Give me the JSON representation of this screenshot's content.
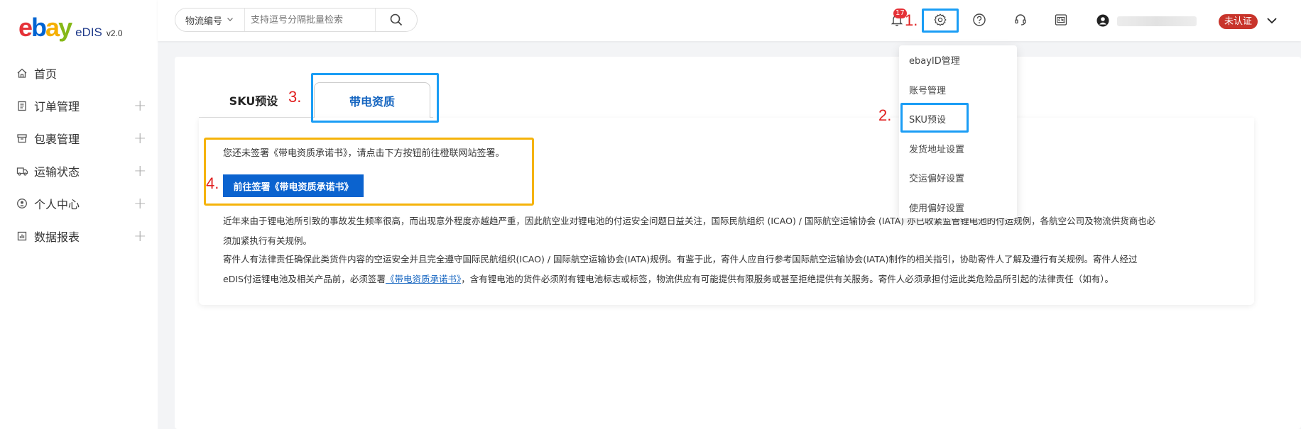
{
  "app": {
    "logo_letters": [
      "e",
      "b",
      "a",
      "y"
    ],
    "product": "eDIS",
    "version": "v2.0"
  },
  "sidebar": {
    "items": [
      {
        "label": "首页",
        "icon": "home-icon",
        "expandable": false
      },
      {
        "label": "订单管理",
        "icon": "clipboard-icon",
        "expandable": true
      },
      {
        "label": "包裹管理",
        "icon": "package-icon",
        "expandable": true
      },
      {
        "label": "运输状态",
        "icon": "truck-icon",
        "expandable": true
      },
      {
        "label": "个人中心",
        "icon": "user-circle-icon",
        "expandable": true
      },
      {
        "label": "数据报表",
        "icon": "chart-icon",
        "expandable": true
      }
    ],
    "expand_symbol": "+"
  },
  "topbar": {
    "search": {
      "select_label": "物流编号",
      "placeholder": "支持逗号分隔批量检索"
    },
    "notification_count": "17",
    "user": {
      "status_badge": "未认证"
    }
  },
  "dropdown": {
    "items": [
      "ebayID管理",
      "账号管理",
      "SKU预设",
      "发货地址设置",
      "交运偏好设置",
      "使用偏好设置"
    ]
  },
  "tabs": [
    {
      "label": "SKU预设",
      "active": false
    },
    {
      "label": "带电资质",
      "active": true
    }
  ],
  "content": {
    "notice": "您还未签署《带电资质承诺书》，请点击下方按钮前往橙联网站签署。",
    "sign_button": "前往签署《带电资质承诺书》",
    "para1_line1": "近年来由于锂电池所引致的事故发生频率很高，而出现意外程度亦越趋严重，因此航空业对锂电池的付运安全问题日益关注，国际民航组织 (ICAO) / 国际航空运输协会 (IATA) 亦已收紧监管锂电池的付运规例，各航空公司及物流供货商也必",
    "para1_line2": "须加紧执行有关规例。",
    "para2_line1": "寄件人有法律责任确保此类货件内容的空运安全并且完全遵守国际民航组织(ICAO) / 国际航空运输协会(IATA)规例。有鉴于此，寄件人应自行参考国际航空运输协会(IATA)制作的相关指引，协助寄件人了解及遵行有关规例。寄件人经过",
    "para2_line2_pre": "eDIS付运锂电池及相关产品前，必须签署",
    "para2_link": "《带电资质承诺书》",
    "para2_line2_post": "，含有锂电池的货件必须附有锂电池标志或标签，物流供应有可能提供有限服务或甚至拒绝提供有关服务。寄件人必须承担付运此类危险品所引起的法律责任（如有）。"
  },
  "annotations": {
    "step1": "1.",
    "step2": "2.",
    "step3": "3.",
    "step4": "4."
  },
  "colors": {
    "ebay_red": "#e53238",
    "ebay_blue": "#0064d2",
    "ebay_yellow": "#f5af02",
    "ebay_green": "#86b817",
    "primary_button": "#0b63cf",
    "highlight_blue": "#1a9df5",
    "highlight_yellow": "#f5b30a",
    "annotation_red": "#e02020",
    "unverified_badge": "#c8342b"
  }
}
